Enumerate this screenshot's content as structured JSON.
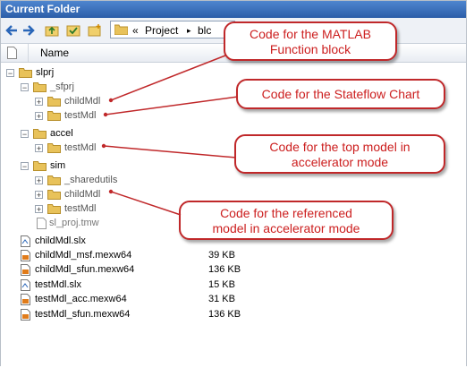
{
  "window": {
    "title": "Current Folder"
  },
  "toolbar": {
    "path_prefix": "«",
    "path_segment": "Project",
    "path_sep": "▸",
    "path_tail": "blc"
  },
  "columns": {
    "name": "Name"
  },
  "tree": [
    {
      "label": "slprj",
      "type": "folder",
      "expanded": true
    },
    {
      "label": "_sfprj",
      "type": "folder",
      "expanded": true
    },
    {
      "label": "childMdl",
      "type": "folder",
      "expanded": false
    },
    {
      "label": "testMdl",
      "type": "folder",
      "expanded": false
    },
    {
      "label": "accel",
      "type": "folder",
      "expanded": true
    },
    {
      "label": "testMdl",
      "type": "folder",
      "expanded": false
    },
    {
      "label": "sim",
      "type": "folder",
      "expanded": true
    },
    {
      "label": "_sharedutils",
      "type": "folder",
      "expanded": false
    },
    {
      "label": "childMdl",
      "type": "folder",
      "expanded": false
    },
    {
      "label": "testMdl",
      "type": "folder",
      "expanded": false
    },
    {
      "label": "sl_proj.tmw",
      "type": "file"
    }
  ],
  "files": [
    {
      "name": "childMdl.slx",
      "size": ""
    },
    {
      "name": "childMdl_msf.mexw64",
      "size": "39 KB"
    },
    {
      "name": "childMdl_sfun.mexw64",
      "size": "136 KB"
    },
    {
      "name": "testMdl.slx",
      "size": "15 KB"
    },
    {
      "name": "testMdl_acc.mexw64",
      "size": "31 KB"
    },
    {
      "name": "testMdl_sfun.mexw64",
      "size": "136 KB"
    }
  ],
  "callouts": [
    {
      "line1": "Code for the MATLAB",
      "line2": "Function block"
    },
    {
      "line1": "Code for the Stateflow Chart",
      "line2": ""
    },
    {
      "line1": "Code for the top model in",
      "line2": "accelerator mode"
    },
    {
      "line1": "Code for the referenced",
      "line2": "model in accelerator mode"
    }
  ],
  "colors": {
    "title_bar": "#2b5da8",
    "callout_border": "#c0282a",
    "callout_text": "#cc1e1e",
    "folder": "#e8c25a"
  }
}
